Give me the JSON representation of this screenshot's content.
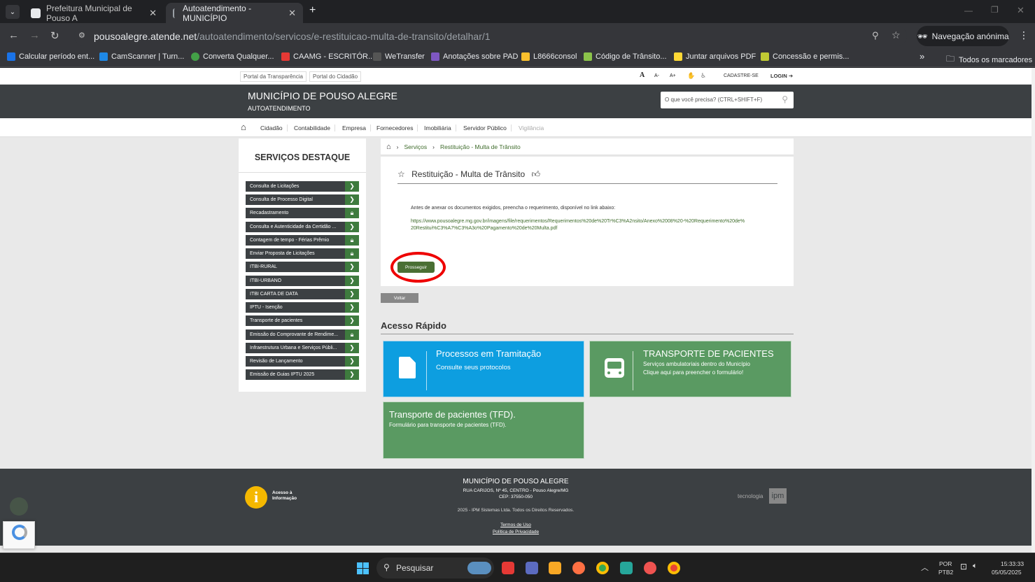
{
  "browser": {
    "tabs": [
      {
        "title": "Prefeitura Municipal de Pouso A"
      },
      {
        "title": "Autoatendimento - MUNICÍPIO"
      }
    ],
    "url_domain": "pousoalegre.atende.net",
    "url_path": "/autoatendimento/servicos/e-restituicao-multa-de-transito/detalhar/1",
    "incognito_label": "Navegação anónima",
    "bookmarks": [
      {
        "label": "Calcular período ent...",
        "color": "#1a73e8"
      },
      {
        "label": "CamScanner | Turn...",
        "color": "#1e88e5"
      },
      {
        "label": "Converta Qualquer...",
        "color": "#43a047"
      },
      {
        "label": "CAAMG - ESCRITÓR...",
        "color": "#e53935"
      },
      {
        "label": "WeTransfer",
        "color": "#555555"
      },
      {
        "label": "Anotações sobre PAD",
        "color": "#7e57c2"
      },
      {
        "label": "L8666consol",
        "color": "#fbc02d"
      },
      {
        "label": "Código de Trânsito...",
        "color": "#8bc34a"
      },
      {
        "label": "Juntar arquivos PDF",
        "color": "#fdd835"
      },
      {
        "label": "Concessão e permis...",
        "color": "#c0ca33"
      }
    ],
    "all_bookmarks": "Todos os marcadores",
    "more": "»"
  },
  "page": {
    "top_links": [
      "Portal da Transparência",
      "Portal do Cidadão"
    ],
    "top_right": {
      "a": "A",
      "a_minus": "A-",
      "a_plus": "A+",
      "register": "CADASTRE-SE",
      "login": "LOGIN"
    },
    "header": {
      "title": "MUNICÍPIO DE POUSO ALEGRE",
      "subtitle": "AUTOATENDIMENTO",
      "search_placeholder": "O que você precisa? (CTRL+SHIFT+F)"
    },
    "nav": [
      "Cidadão",
      "Contabilidade",
      "Empresa",
      "Fornecedores",
      "Imobiliária",
      "Servidor Público",
      "Vigilância"
    ],
    "sidebar": {
      "title": "SERVIÇOS DESTAQUE",
      "items": [
        {
          "label": "Consulta de Licitações",
          "icon": "chevron-right"
        },
        {
          "label": "Consulta de Processo Digital",
          "icon": "chevron-right"
        },
        {
          "label": "Recadastramento",
          "icon": "lock"
        },
        {
          "label": "Consulta e Autenticidade da Certidão ...",
          "icon": "chevron-right"
        },
        {
          "label": "Contagem de tempo - Férias Prêmio",
          "icon": "lock"
        },
        {
          "label": "Enviar Proposta de Licitações",
          "icon": "lock"
        },
        {
          "label": "ITBI-RURAL",
          "icon": "chevron-right"
        },
        {
          "label": "ITBI-URBANO",
          "icon": "chevron-right"
        },
        {
          "label": "ITBI CARTA DE DATA",
          "icon": "chevron-right"
        },
        {
          "label": "IPTU - Isenção",
          "icon": "chevron-right"
        },
        {
          "label": "Transporte de pacientes",
          "icon": "chevron-right"
        },
        {
          "label": "Emissão do Comprovante de Rendime...",
          "icon": "lock"
        },
        {
          "label": "Infraestrutura Urbana e Serviços Públi...",
          "icon": "chevron-right"
        },
        {
          "label": "Revisão de Lançamento",
          "icon": "chevron-right"
        },
        {
          "label": "Emissão de Guias IPTU 2025",
          "icon": "chevron-right"
        }
      ]
    },
    "breadcrumb": {
      "services": "Serviços",
      "current": "Restituição - Multa de Trânsito"
    },
    "card": {
      "title": "Restituição - Multa de Trânsito",
      "intro": "Antes de anexar os documentos exigidos, preencha o requerimento, disponível no link abaixo:",
      "link": "https://www.pousoalegre.mg.gov.br/imagens/file/requerimentos/Requerimentos%20de%20Tr%C3%A2nsito/Anexo%2008%20-%20Requerimento%20de%20Restitui%C3%A7%C3%A3o%20Pagamento%20de%20Multa.pdf",
      "proceed": "Prosseguir"
    },
    "back": "Voltar",
    "quick_access": {
      "title": "Acesso Rápido",
      "tiles": [
        {
          "title": "Processos em Tramitação",
          "subtitle": "Consulte seus protocolos",
          "color": "#0d9ee0"
        },
        {
          "title": "TRANSPORTE DE PACIENTES",
          "line1": "Serviços ambulatoriais dentro do Município",
          "line2": "Clique aqui para preencher o formulário!",
          "color": "#5a9a62"
        },
        {
          "title": "Transporte de pacientes (TFD).",
          "subtitle": "Formulário para transporte de pacientes (TFD).",
          "color": "#5a9a62"
        }
      ]
    },
    "footer": {
      "info_label_1": "Acesso à",
      "info_label_2": "Informação",
      "title": "MUNICÍPIO DE POUSO ALEGRE",
      "address": "RUA CARIJOS, Nº 45, CENTRO - Pouso Alegre/MG",
      "cep": "CEP: 37550-050",
      "copyright": "2025 - IPM Sistemas Ltda. Todos os Direitos Reservados.",
      "terms": "Termos de Uso",
      "privacy": "Política de Privacidade",
      "tech": "tecnologia",
      "ipm": "ipm"
    }
  },
  "taskbar": {
    "search": "Pesquisar",
    "lang": "POR",
    "layout": "PTB2",
    "time": "15:33:33",
    "date": "05/05/2025"
  }
}
